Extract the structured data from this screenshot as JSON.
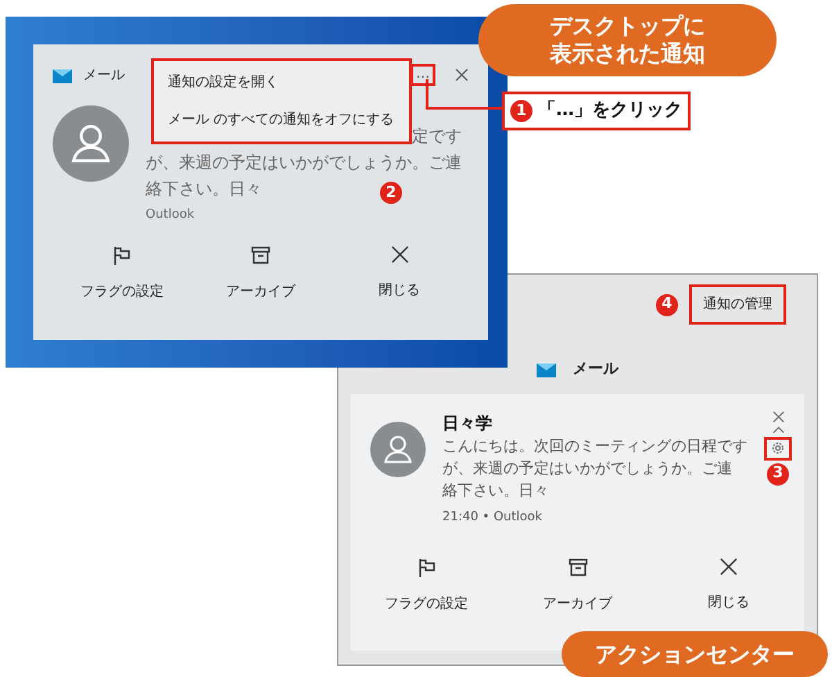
{
  "desktop_notification": {
    "app": "メール",
    "more_button": "…",
    "menu": {
      "items": [
        "通知の設定を開く",
        "メール のすべての通知をオフにする"
      ]
    },
    "body_lines": [
      "定です",
      "が、来週の予定はいかがでしょうか。ご連",
      "絡下さい。日々"
    ],
    "source": "Outlook",
    "actions": [
      {
        "kind": "flag",
        "label": "フラグの設定"
      },
      {
        "kind": "archive",
        "label": "アーカイブ"
      },
      {
        "kind": "close",
        "label": "閉じる"
      }
    ]
  },
  "desktop_caption": [
    "デスクトップに",
    "表示された通知"
  ],
  "step_1": {
    "number": "1",
    "text": "「…」をクリック"
  },
  "step_2": {
    "number": "2"
  },
  "action_center": {
    "manage_button": "通知の管理",
    "app": "メール",
    "notification": {
      "sender": "日々学",
      "body_lines": [
        "こんにちは。次回のミーティングの日程です",
        "が、来週の予定はいかがでしょうか。ご連",
        "絡下さい。日々"
      ],
      "meta": "21:40 • Outlook"
    },
    "actions": [
      {
        "kind": "flag",
        "label": "フラグの設定"
      },
      {
        "kind": "archive",
        "label": "アーカイブ"
      },
      {
        "kind": "close",
        "label": "閉じる"
      }
    ]
  },
  "step_3": {
    "number": "3"
  },
  "step_4": {
    "number": "4"
  },
  "action_center_caption": "アクションセンター"
}
